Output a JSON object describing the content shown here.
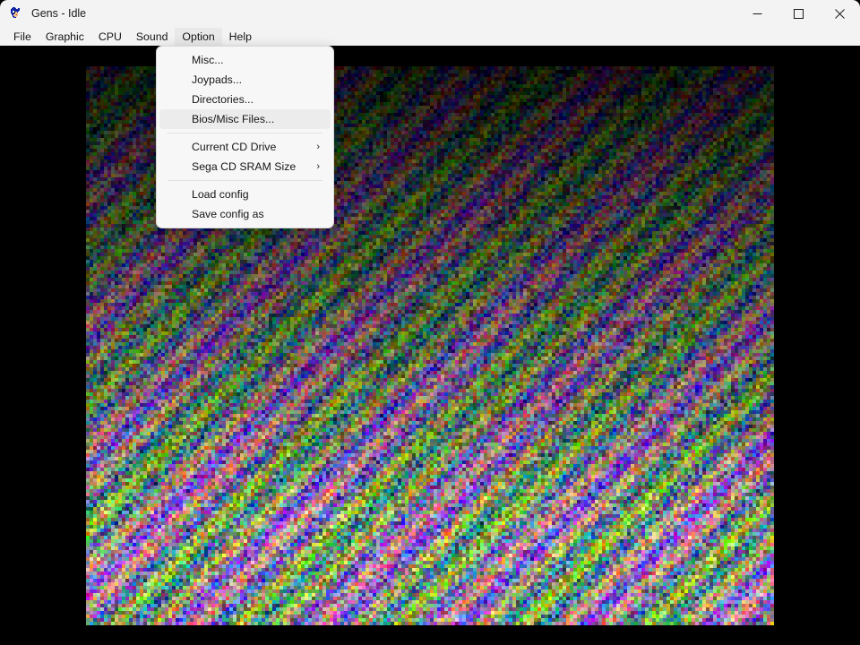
{
  "window": {
    "title": "Gens - Idle",
    "icon": "sonic-sprite-icon",
    "controls": {
      "minimize": "minimize-icon",
      "maximize": "maximize-icon",
      "close": "close-icon"
    }
  },
  "menubar": {
    "items": [
      {
        "label": "File",
        "active": false
      },
      {
        "label": "Graphic",
        "active": false
      },
      {
        "label": "CPU",
        "active": false
      },
      {
        "label": "Sound",
        "active": false
      },
      {
        "label": "Option",
        "active": true
      },
      {
        "label": "Help",
        "active": false
      }
    ]
  },
  "dropdown": {
    "owner": "Option",
    "items": [
      {
        "label": "Misc...",
        "type": "item",
        "highlighted": false,
        "submenu": false
      },
      {
        "label": "Joypads...",
        "type": "item",
        "highlighted": false,
        "submenu": false
      },
      {
        "label": "Directories...",
        "type": "item",
        "highlighted": false,
        "submenu": false
      },
      {
        "label": "Bios/Misc Files...",
        "type": "item",
        "highlighted": true,
        "submenu": false
      },
      {
        "label": "",
        "type": "separator",
        "highlighted": false,
        "submenu": false
      },
      {
        "label": "Current CD Drive",
        "type": "item",
        "highlighted": false,
        "submenu": true
      },
      {
        "label": "Sega CD SRAM Size",
        "type": "item",
        "highlighted": false,
        "submenu": true
      },
      {
        "label": "",
        "type": "separator",
        "highlighted": false,
        "submenu": false
      },
      {
        "label": "Load config",
        "type": "item",
        "highlighted": false,
        "submenu": false
      },
      {
        "label": "Save config as",
        "type": "item",
        "highlighted": false,
        "submenu": false
      }
    ],
    "submenu_arrow_glyph": "›"
  },
  "viewport": {
    "content": "static-noise",
    "background_color": "#000000"
  },
  "colors": {
    "titlebar_bg": "#f3f3f3",
    "menubar_bg": "#f3f3f3",
    "menu_bg": "#f7f7f7",
    "menu_highlight": "#ececec",
    "text": "#161616",
    "separator": "#e2e2e2"
  }
}
